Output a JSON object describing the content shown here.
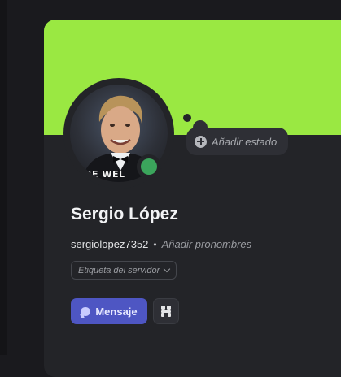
{
  "colors": {
    "banner": "#9ae842",
    "online": "#3ba55c",
    "brand": "#4e56c3"
  },
  "avatar": {
    "overlay_text": "RE WEL",
    "icon": "avatar-photo"
  },
  "status": {
    "label": "Añadir estado",
    "icon": "plus-circle-icon"
  },
  "profile": {
    "display_name": "Sergio López",
    "username": "sergiolopez7352",
    "separator": "•",
    "pronouns_placeholder": "Añadir pronombres",
    "server_tag_label": "Etiqueta del servidor"
  },
  "actions": {
    "message_label": "Mensaje",
    "friend_icon": "friend-request-icon"
  }
}
